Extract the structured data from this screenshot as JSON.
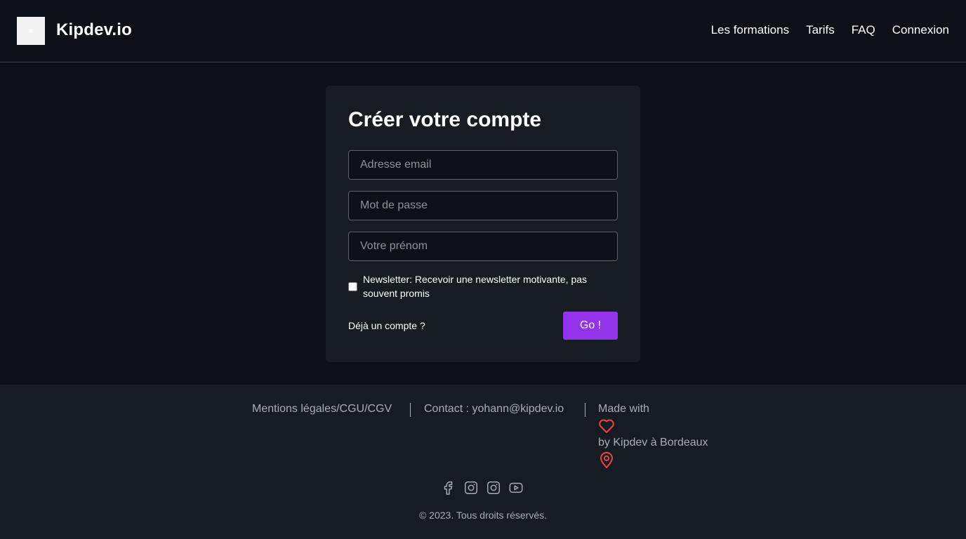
{
  "header": {
    "brand": "Kipdev.io",
    "nav": [
      "Les formations",
      "Tarifs",
      "FAQ",
      "Connexion"
    ]
  },
  "form": {
    "title": "Créer votre compte",
    "email_placeholder": "Adresse email",
    "password_placeholder": "Mot de passe",
    "firstname_placeholder": "Votre prénom",
    "newsletter_label": "Newsletter: Recevoir une newsletter motivante, pas souvent promis",
    "newsletter_checked": false,
    "already_account": "Déjà un compte ?",
    "submit_label": "Go !"
  },
  "footer": {
    "legal": "Mentions légales/CGU/CGV",
    "contact": "Contact : yohann@kipdev.io",
    "made_with": "Made with",
    "by_line": "by Kipdev à Bordeaux",
    "copyright": "© 2023. Tous droits réservés.",
    "social_icons": [
      "facebook-icon",
      "instagram-icon",
      "instagram-icon",
      "youtube-icon"
    ]
  },
  "colors": {
    "background": "#0d1017",
    "card": "#171b22",
    "accent": "#9333ea",
    "heart": "#ef4444",
    "muted_text": "#a7adb6"
  }
}
